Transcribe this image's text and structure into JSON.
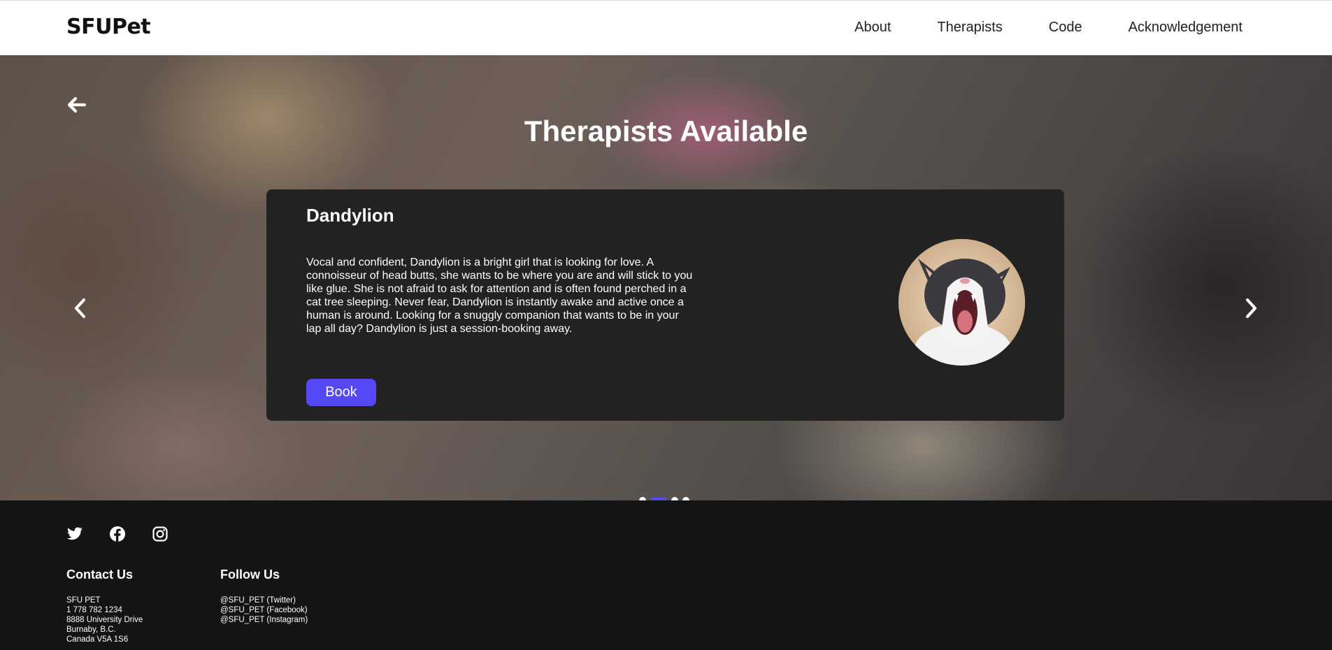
{
  "navbar": {
    "brand": "SFUPet",
    "links": [
      "About",
      "Therapists",
      "Code",
      "Acknowledgement"
    ]
  },
  "hero": {
    "title": "Therapists Available",
    "back_icon": "arrow-left-icon",
    "prev_icon": "chevron-left-icon",
    "next_icon": "chevron-right-icon"
  },
  "card": {
    "name": "Dandylion",
    "description": "Vocal and confident, Dandylion is a bright girl that is looking for love. A connoisseur of head butts, she wants to be where you are and will stick to you like glue. She is not afraid to ask for attention and is often found perched in a cat tree sleeping. Never fear, Dandylion is instantly awake and active once a human is around. Looking for a snuggly companion that wants to be in your lap all day? Dandylion is just a session-booking away.",
    "book_label": "Book"
  },
  "carousel": {
    "slides": 4,
    "active_index": 1
  },
  "footer": {
    "social_icons": [
      "twitter-icon",
      "facebook-icon",
      "instagram-icon"
    ],
    "contact": {
      "heading": "Contact Us",
      "lines": [
        "SFU PET",
        "1 778 782 1234",
        "8888 University Drive",
        "Burnaby, B.C.",
        "Canada V5A 1S6"
      ]
    },
    "follow": {
      "heading": "Follow Us",
      "lines": [
        "@SFU_PET (Twitter)",
        "@SFU_PET (Facebook)",
        "@SFU_PET (Instagram)"
      ]
    }
  },
  "colors": {
    "accent": "#5449f5",
    "card_bg": "#222222",
    "footer_bg": "#141414"
  }
}
